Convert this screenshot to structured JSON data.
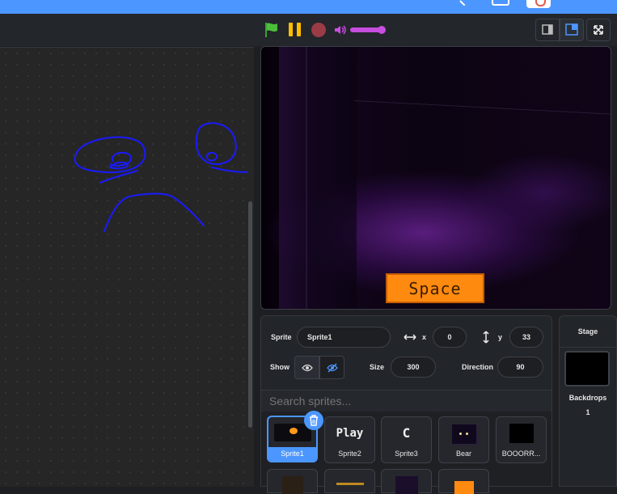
{
  "controls": {
    "green_flag_icon": "green-flag-icon",
    "pause_icon": "pause-icon",
    "stop_icon": "stop-icon",
    "volume_level": 0.85
  },
  "stage": {
    "button_text": "Space"
  },
  "sprite_info": {
    "sprite_label": "Sprite",
    "sprite_name": "Sprite1",
    "x_label": "x",
    "x_value": "0",
    "y_label": "y",
    "y_value": "33",
    "show_label": "Show",
    "size_label": "Size",
    "size_value": "300",
    "direction_label": "Direction",
    "direction_value": "90"
  },
  "search": {
    "placeholder": "Search sprites..."
  },
  "sprites": [
    {
      "name": "Sprite1",
      "selected": true
    },
    {
      "name": "Sprite2",
      "thumb_text": "Play"
    },
    {
      "name": "Sprite3",
      "thumb_text": "C"
    },
    {
      "name": "Bear"
    },
    {
      "name": "BOOORR..."
    }
  ],
  "stage_panel": {
    "title": "Stage",
    "backdrops_label": "Backdrops",
    "backdrops_count": "1"
  },
  "colors": {
    "accent": "#4c97ff",
    "volume": "#c84ee0",
    "space_button": "#ff8a10",
    "doodle": "#1a1aff"
  }
}
